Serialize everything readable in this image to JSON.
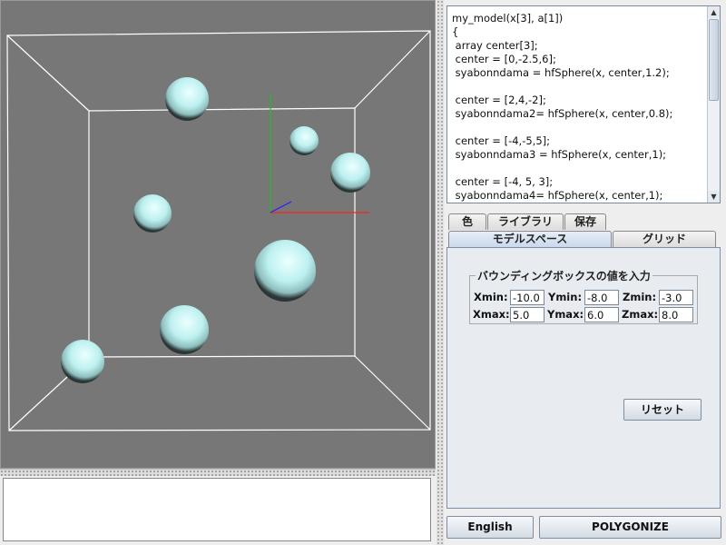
{
  "code_lines": [
    "my_model(x[3], a[1])",
    "{",
    " array center[3];",
    " center = [0,-2.5,6];",
    " syabonndama = hfSphere(x, center,1.2);",
    "",
    " center = [2,4,-2];",
    " syabonndama2= hfSphere(x, center,0.8);",
    "",
    " center = [-4,-5,5];",
    " syabonndama3 = hfSphere(x, center,1);",
    "",
    " center = [-4, 5, 3];",
    " syabonndama4= hfSphere(x, center,1);"
  ],
  "tabs_row1": [
    "色",
    "ライブラリ",
    "保存"
  ],
  "tabs_row2": [
    "モデルスペース",
    "グリッド"
  ],
  "active_tab": "モデルスペース",
  "bbox_group": {
    "title": "バウンディングボックスの値を入力",
    "xmin_label": "Xmin:",
    "xmin": "-10.0",
    "ymin_label": "Ymin:",
    "ymin": "-8.0",
    "zmin_label": "Zmin:",
    "zmin": "-3.0",
    "xmax_label": "Xmax:",
    "xmax": "5.0",
    "ymax_label": "Ymax:",
    "ymax": "6.0",
    "zmax_label": "Zmax:",
    "zmax": "8.0"
  },
  "reset_label": "リセット",
  "english_label": "English",
  "polygonize_label": "POLYGONIZE",
  "colors": {
    "viewport_bg": "#777777",
    "box_lines": "#ffffff",
    "axis_x": "#ff2020",
    "axis_y": "#20c020",
    "axis_z": "#2020ff",
    "sphere": "#c8f4f4"
  }
}
